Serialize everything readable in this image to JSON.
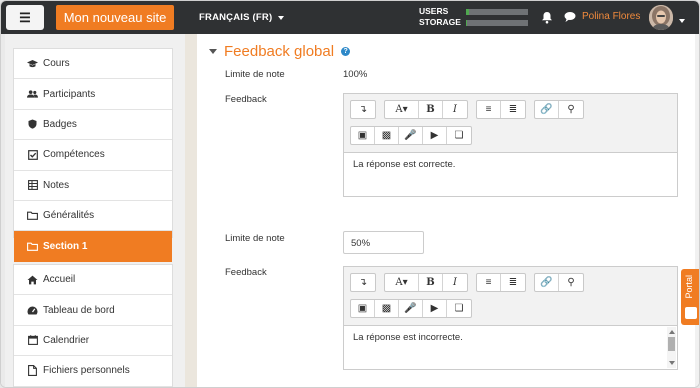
{
  "navbar": {
    "menu_icon": "hamburger-icon",
    "site_name": "Mon nouveau site",
    "language": "FRANÇAIS (FR)",
    "usage": [
      {
        "label": "USERS",
        "fraction": 0.05
      },
      {
        "label": "STORAGE",
        "fraction": 0.02
      }
    ],
    "user_name": "Polina Flores"
  },
  "sidebar": {
    "items": [
      {
        "label": "Cours",
        "icon": "graduation-cap-icon"
      },
      {
        "label": "Participants",
        "icon": "users-icon"
      },
      {
        "label": "Badges",
        "icon": "shield-icon"
      },
      {
        "label": "Compétences",
        "icon": "check-square-icon"
      },
      {
        "label": "Notes",
        "icon": "table-icon"
      },
      {
        "label": "Généralités",
        "icon": "folder-icon"
      },
      {
        "label": "Section 1",
        "icon": "folder-icon",
        "active": true
      }
    ],
    "items2": [
      {
        "label": "Accueil",
        "icon": "home-icon"
      },
      {
        "label": "Tableau de bord",
        "icon": "dashboard-icon"
      },
      {
        "label": "Calendrier",
        "icon": "calendar-icon"
      },
      {
        "label": "Fichiers personnels",
        "icon": "file-icon"
      }
    ]
  },
  "main": {
    "section_title": "Feedback global",
    "help_icon": "question-circle-icon",
    "rows": [
      {
        "grade_label": "Limite de note",
        "grade_value": "100%",
        "feedback_label": "Feedback",
        "feedback_text": "La réponse est correcte."
      },
      {
        "grade_label": "Limite de note",
        "grade_value": "50%",
        "feedback_label": "Feedback",
        "feedback_text": "La réponse est incorrecte."
      }
    ]
  },
  "editor_toolbar": {
    "row1": [
      "toggle-toolbar-icon",
      "font-style-icon",
      "bold-icon",
      "italic-icon",
      "unordered-list-icon",
      "ordered-list-icon",
      "link-icon",
      "unlink-icon"
    ],
    "row2": [
      "image-icon",
      "media-icon",
      "record-audio-icon",
      "record-video-icon",
      "manage-files-icon"
    ],
    "bold_label": "B",
    "italic_label": "I",
    "font_label": "A"
  },
  "portal_tab": {
    "label": "Portal"
  },
  "colors": {
    "accent": "#f07c22",
    "navbar": "#2f3133",
    "usage_bar": "#4fa84f",
    "help": "#2d88c8"
  }
}
